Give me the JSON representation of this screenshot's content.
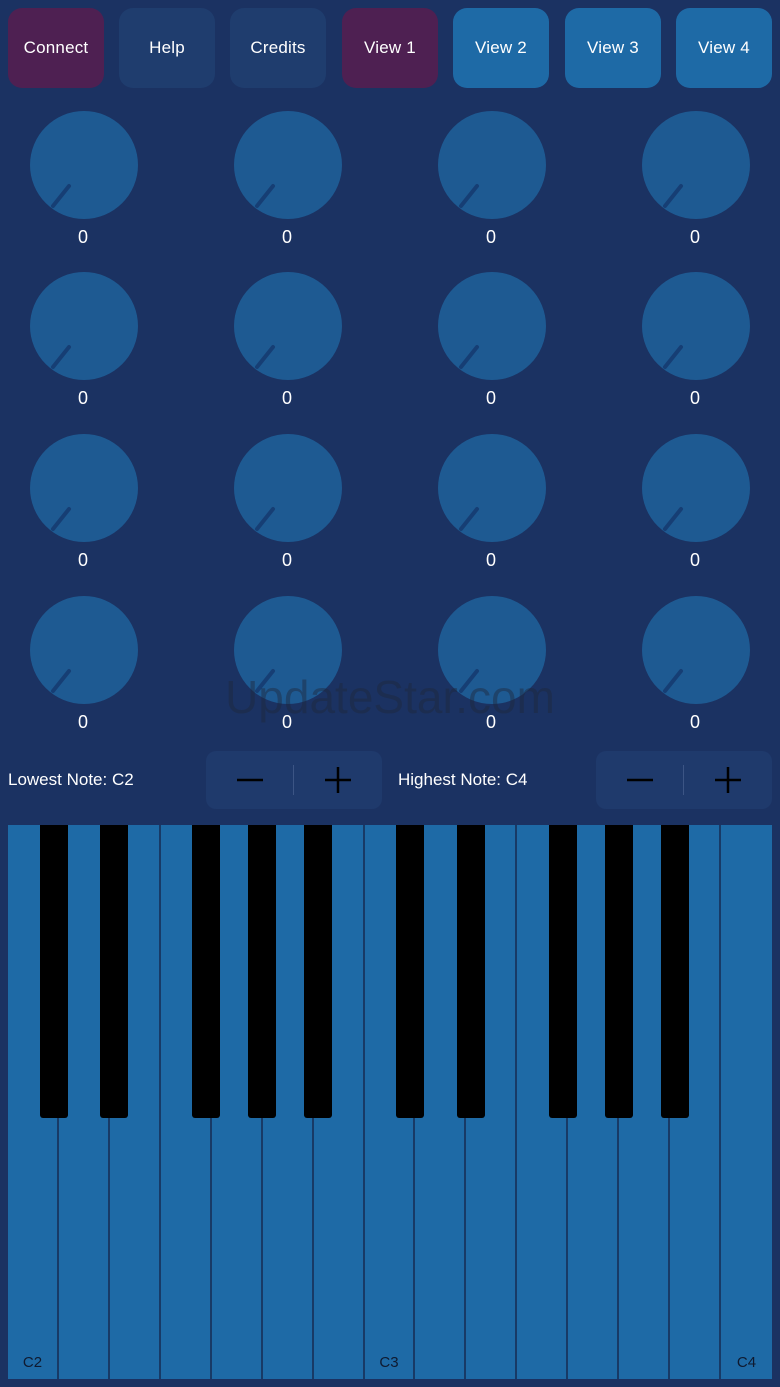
{
  "colors": {
    "background": "#1b3262",
    "active_button": "#4e2052",
    "inactive_button": "#1f3d6e",
    "view_button": "#1e6aa6",
    "knob": "#1e5a92",
    "knob_indicator": "#163e74",
    "white_key": "#1e6aa6",
    "black_key": "#000000"
  },
  "top_buttons": [
    {
      "label": "Connect"
    },
    {
      "label": "Help"
    },
    {
      "label": "Credits"
    },
    {
      "label": "View 1"
    },
    {
      "label": "View 2"
    },
    {
      "label": "View 3"
    },
    {
      "label": "View 4"
    }
  ],
  "knobs": [
    {
      "value": "0"
    },
    {
      "value": "0"
    },
    {
      "value": "0"
    },
    {
      "value": "0"
    },
    {
      "value": "0"
    },
    {
      "value": "0"
    },
    {
      "value": "0"
    },
    {
      "value": "0"
    },
    {
      "value": "0"
    },
    {
      "value": "0"
    },
    {
      "value": "0"
    },
    {
      "value": "0"
    },
    {
      "value": "0"
    },
    {
      "value": "0"
    },
    {
      "value": "0"
    },
    {
      "value": "0"
    }
  ],
  "lowest_note": {
    "label": "Lowest Note: C2"
  },
  "highest_note": {
    "label": "Highest Note: C4"
  },
  "keyboard": {
    "white_key_labels": [
      "C2",
      "",
      "",
      "",
      "",
      "",
      "",
      "C3",
      "",
      "",
      "",
      "",
      "",
      "",
      "C4"
    ]
  },
  "watermark": "UpdateStar.com"
}
